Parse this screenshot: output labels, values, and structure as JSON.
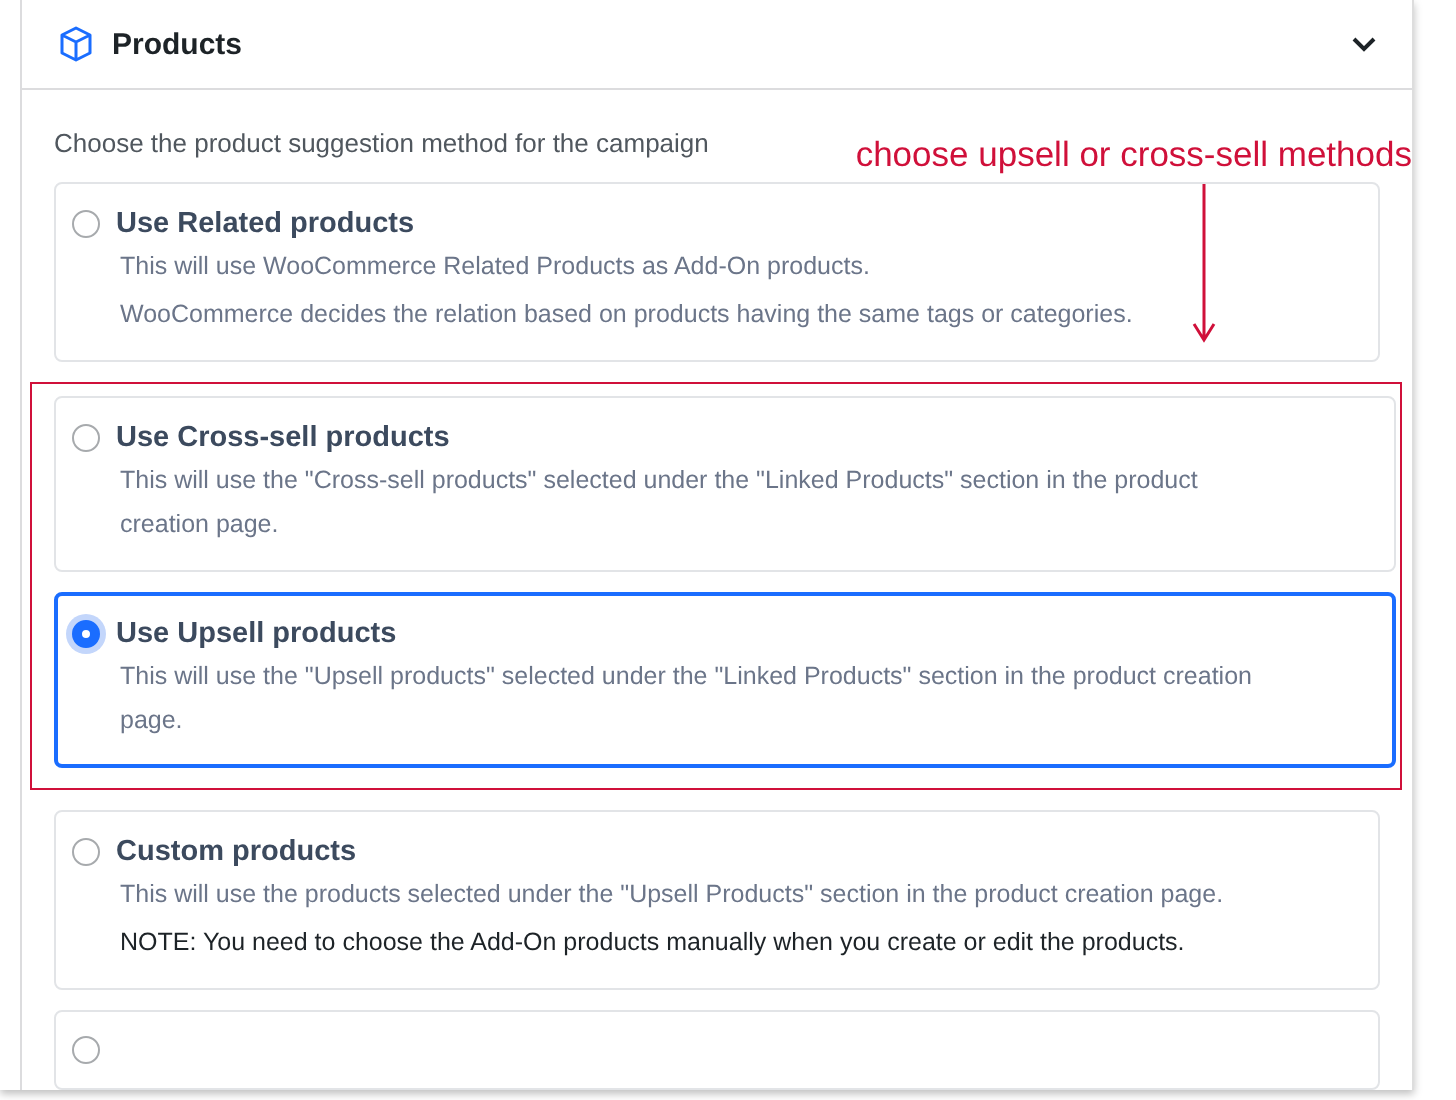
{
  "panel": {
    "title": "Products",
    "expanded": true
  },
  "prompt": "Choose the product suggestion method for the campaign",
  "annotation": {
    "text": "choose upsell or cross-sell methods"
  },
  "options": [
    {
      "title": "Use Related products",
      "selected": false,
      "marked": false,
      "lines": [
        {
          "kind": "hint",
          "text": "This will use WooCommerce Related Products as Add-On products."
        },
        {
          "kind": "hint",
          "text": "WooCommerce decides the relation based on products having the same tags or categories."
        }
      ]
    },
    {
      "title": "Use Cross-sell products",
      "selected": false,
      "marked": true,
      "lines": [
        {
          "kind": "hint",
          "text": "This will use the \"Cross-sell products\" selected under the \"Linked Products\" section in the product creation page."
        }
      ]
    },
    {
      "title": "Use Upsell products",
      "selected": true,
      "marked": true,
      "lines": [
        {
          "kind": "hint",
          "text": "This will use the \"Upsell products\" selected under the \"Linked Products\" section in the product creation page."
        }
      ]
    },
    {
      "title": "Custom products",
      "selected": false,
      "marked": false,
      "lines": [
        {
          "kind": "hint",
          "text": "This will use the products selected under the \"Upsell Products\" section in the product creation page."
        },
        {
          "kind": "note",
          "text": "NOTE: You need to choose the Add-On products manually when you create or edit the products."
        }
      ]
    },
    {
      "selected": false,
      "marked": false
    }
  ]
}
